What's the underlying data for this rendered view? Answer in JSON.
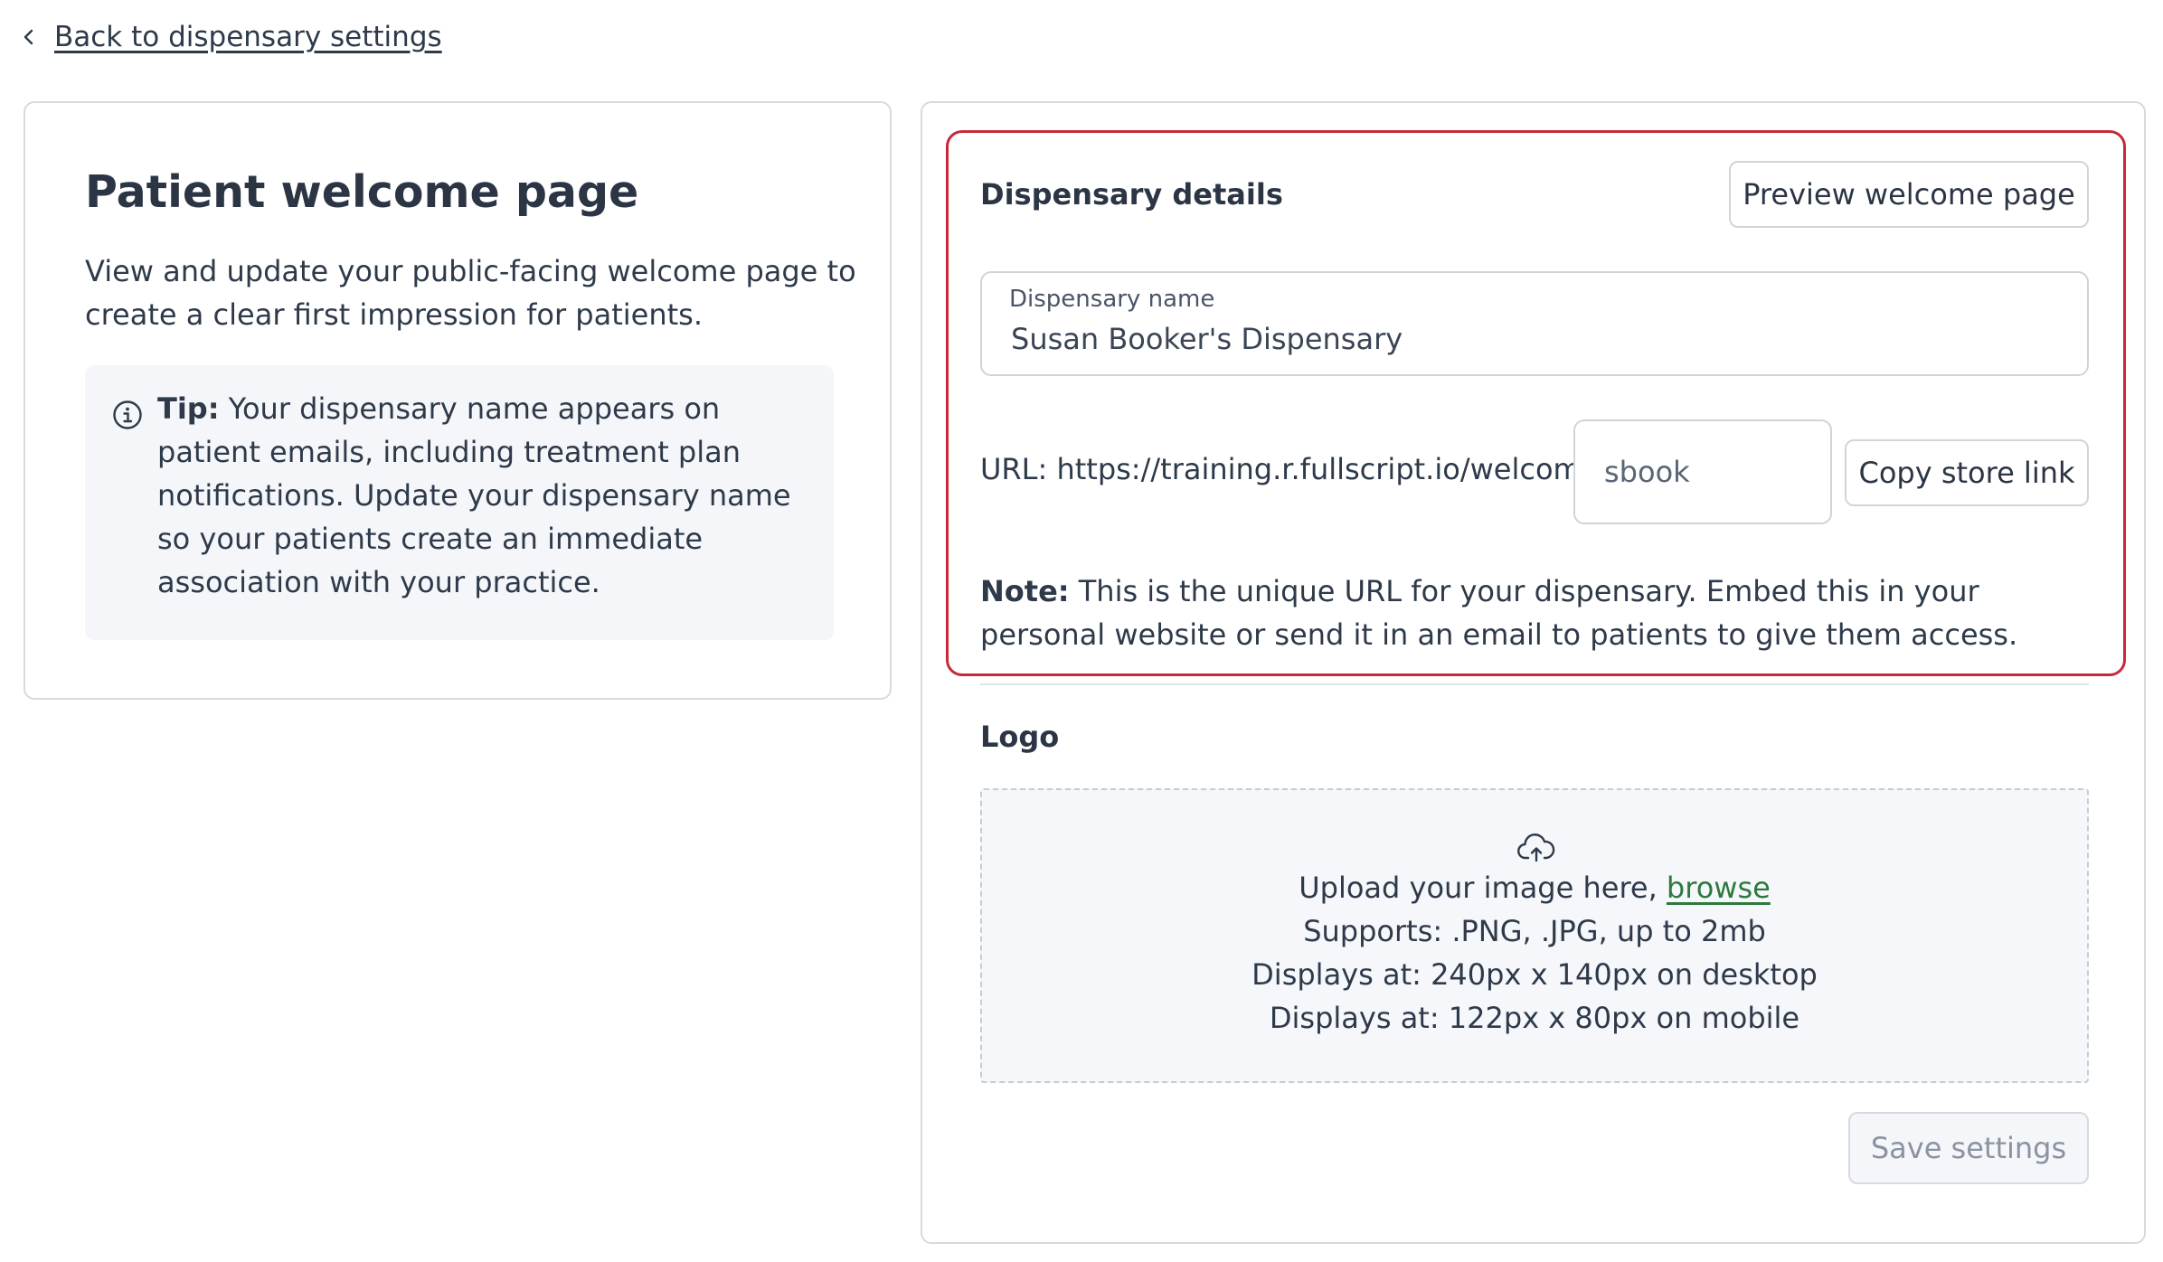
{
  "nav": {
    "back_label": "Back to dispensary settings"
  },
  "intro": {
    "title": "Patient welcome page",
    "description": "View and update your public-facing welcome page to create a clear first impression for patients.",
    "tip_label": "Tip:",
    "tip_text": "Your dispensary name appears on patient emails, including treatment plan notifications. Update your dispensary name so your patients create an immediate association with your practice."
  },
  "details": {
    "title": "Dispensary details",
    "preview_button": "Preview welcome page",
    "name_label": "Dispensary name",
    "name_value": "Susan Booker's Dispensary",
    "url_prefix": "URL: https://training.r.fullscript.io/welcome/",
    "url_slug": "sbook",
    "copy_button": "Copy store link",
    "note_label": "Note:",
    "note_text": "This is the unique URL for your dispensary. Embed this in your personal website or send it in an email to patients to give them access."
  },
  "logo": {
    "title": "Logo",
    "upload_text": "Upload your image here,",
    "browse_link": "browse",
    "supports": "Supports: .PNG, .JPG, up to 2mb",
    "desktop_size": "Displays at: 240px x 140px on desktop",
    "mobile_size": "Displays at: 122px x 80px on mobile"
  },
  "actions": {
    "save_button": "Save settings"
  },
  "colors": {
    "highlight_border": "#c8283a",
    "link_green": "#2d7a3e",
    "text": "#2e3a4a",
    "panel_bg": "#f4f6f9"
  },
  "icons": [
    "chevron-left-icon",
    "info-icon",
    "cloud-upload-icon"
  ]
}
